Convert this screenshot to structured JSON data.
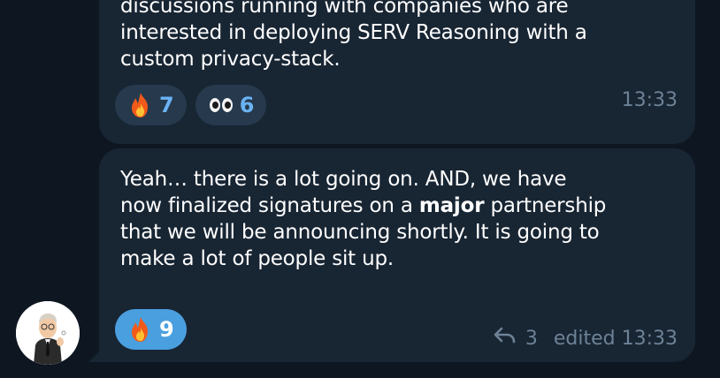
{
  "colors": {
    "background": "#0e1621",
    "bubble": "#182533",
    "reaction_bg": "#26394d",
    "reaction_chosen_bg": "#4a9fdf",
    "reaction_count": "#6ab3f3",
    "meta_text": "#6d8296"
  },
  "messages": [
    {
      "lines": [
        "discussions running with companies who are",
        "interested in deploying SERV Reasoning with a",
        "custom privacy-stack."
      ],
      "reactions": [
        {
          "emoji": "🔥",
          "icon": "fire-icon",
          "count": "7",
          "chosen": false
        },
        {
          "emoji": "👀",
          "icon": "eyes-icon",
          "count": "6",
          "chosen": false
        }
      ],
      "time": "13:33"
    },
    {
      "lines": [
        {
          "parts": [
            "Yeah… there is a lot going on. AND, we have"
          ]
        },
        {
          "parts": [
            "now finalized signatures on a ",
            "major",
            " partnership"
          ]
        },
        {
          "parts": [
            "that we will be announcing shortly. It is going to"
          ]
        },
        {
          "parts": [
            "make a lot of people sit up."
          ]
        }
      ],
      "reactions": [
        {
          "emoji": "🔥",
          "icon": "fire-icon",
          "count": "9",
          "chosen": true
        }
      ],
      "reply_count": "3",
      "edited_time": "edited 13:33"
    }
  ],
  "sender": {
    "avatar_icon": "avatar"
  }
}
